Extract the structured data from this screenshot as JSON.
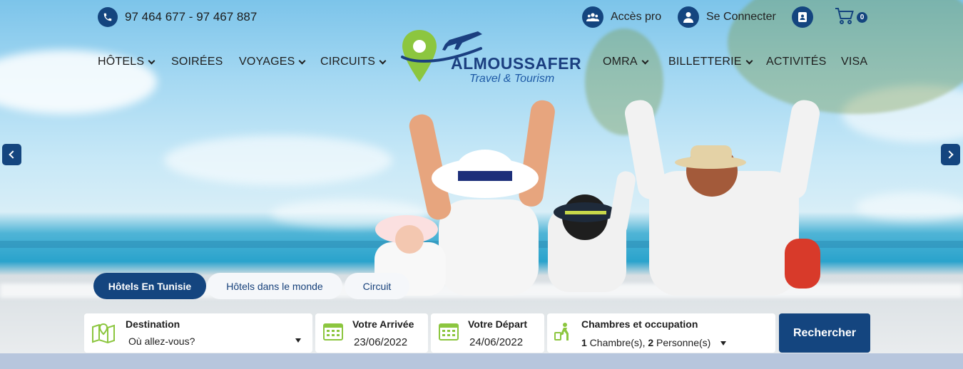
{
  "topbar": {
    "phone": "97 464 677 - 97 467 887",
    "pro_access": "Accès pro",
    "login": "Se Connecter",
    "cart_count": "0"
  },
  "nav": {
    "left": [
      {
        "label": "HÔTELS",
        "dropdown": true
      },
      {
        "label": "SOIRÉES",
        "dropdown": false
      },
      {
        "label": "VOYAGES",
        "dropdown": true
      },
      {
        "label": "CIRCUITS",
        "dropdown": true
      }
    ],
    "right": [
      {
        "label": "OMRA",
        "dropdown": true
      },
      {
        "label": "BILLETTERIE",
        "dropdown": true
      },
      {
        "label": "ACTIVITÉS",
        "dropdown": false
      },
      {
        "label": "VISA",
        "dropdown": false
      }
    ]
  },
  "logo": {
    "brand": "ALMOUSSAFER",
    "tagline": "Travel & Tourism"
  },
  "tabs": [
    {
      "label": "Hôtels En Tunisie",
      "active": true
    },
    {
      "label": "Hôtels dans le monde",
      "active": false
    },
    {
      "label": "Circuit",
      "active": false
    }
  ],
  "search": {
    "destination_label": "Destination",
    "destination_placeholder": "Où allez-vous?",
    "arrival_label": "Votre Arrivée",
    "arrival_value": "23/06/2022",
    "departure_label": "Votre Départ",
    "departure_value": "24/06/2022",
    "rooms_label": "Chambres et occupation",
    "rooms_count": "1",
    "rooms_text": " Chambre(s), ",
    "persons_count": "2",
    "persons_text": " Personne(s)",
    "button": "Rechercher"
  },
  "colors": {
    "primary": "#14457f",
    "accent_green": "#8cc63f"
  },
  "icons": [
    "phone-icon",
    "users-icon",
    "user-icon",
    "contact-book-icon",
    "cart-icon",
    "map-icon",
    "calendar-icon",
    "traveler-icon",
    "chevron-left-icon",
    "chevron-right-icon"
  ]
}
